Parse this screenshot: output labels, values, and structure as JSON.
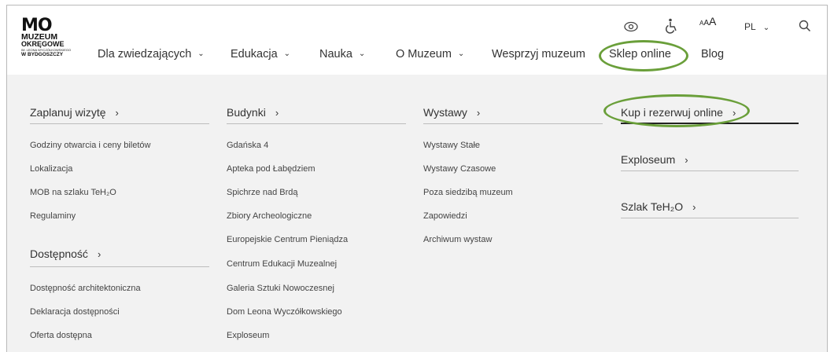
{
  "logo": {
    "mark": "MO",
    "line1": "MUZEUM",
    "line2": "OKRĘGOWE",
    "line3": "IM. LEONA WYCZÓŁKOWSKIEGO",
    "line4": "W BYDGOSZCZY"
  },
  "nav": [
    {
      "label": "Dla zwiedzających",
      "chevron": "⌄"
    },
    {
      "label": "Edukacja",
      "chevron": "⌄"
    },
    {
      "label": "Nauka",
      "chevron": "⌄"
    },
    {
      "label": "O Muzeum",
      "chevron": "⌄"
    },
    {
      "label": "Wesprzyj muzeum"
    },
    {
      "label": "Sklep online"
    },
    {
      "label": "Blog"
    }
  ],
  "utility": {
    "view_icon": "eye-icon",
    "accessibility_icon": "wheelchair-icon",
    "font_size_small": "A",
    "font_size_medium": "A",
    "font_size_large": "A",
    "language": "PL",
    "language_chevron": "⌄",
    "search_icon": "search-icon"
  },
  "highlight_color": "#6a9f3a",
  "mega_menu": {
    "col1": {
      "heading": "Zaplanuj wizytę",
      "links": [
        "Godziny otwarcia i ceny biletów",
        "Lokalizacja",
        "MOB na szlaku TeH₂O",
        "Regulaminy"
      ],
      "heading2": "Dostępność",
      "links2": [
        "Dostępność architektoniczna",
        "Deklaracja dostępności",
        "Oferta dostępna"
      ]
    },
    "col2": {
      "heading": "Budynki",
      "links": [
        "Gdańska 4",
        "Apteka pod Łabędziem",
        "Spichrze nad Brdą",
        "Zbiory Archeologiczne",
        "Europejskie Centrum Pieniądza",
        "Centrum Edukacji Muzealnej",
        "Galeria Sztuki Nowoczesnej",
        "Dom Leona Wyczółkowskiego",
        "Exploseum"
      ]
    },
    "col3": {
      "heading": "Wystawy",
      "links": [
        "Wystawy Stałe",
        "Wystawy Czasowe",
        "Poza siedzibą muzeum",
        "Zapowiedzi",
        "Archiwum wystaw"
      ]
    },
    "col4": {
      "headings": [
        "Kup i rezerwuj online",
        "Exploseum",
        "Szlak TeH₂O"
      ]
    },
    "arrow": "›"
  }
}
